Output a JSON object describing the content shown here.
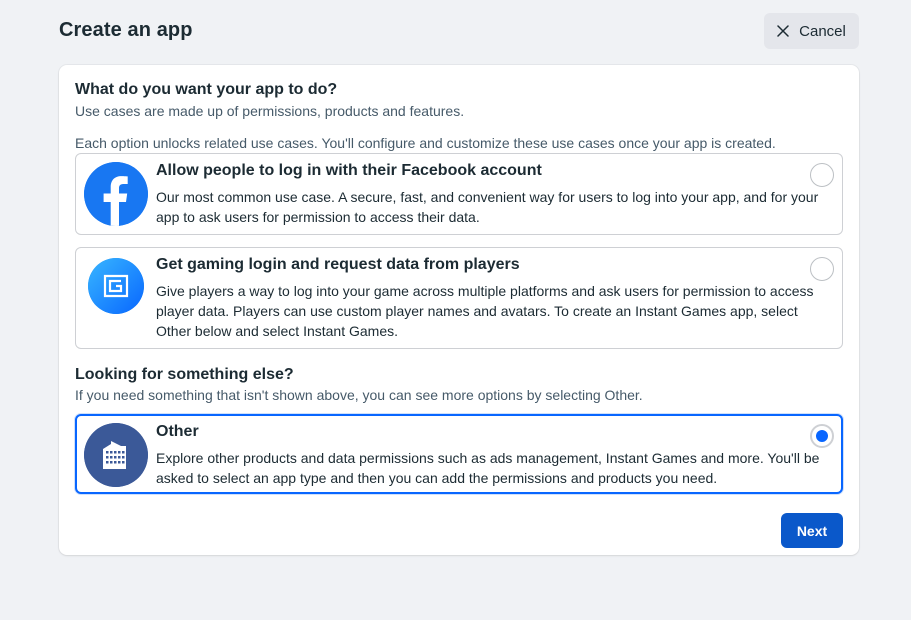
{
  "header": {
    "title": "Create an app",
    "cancel_label": "Cancel"
  },
  "section_main": {
    "title": "What do you want your app to do?",
    "subtitle": "Use cases are made up of permissions, products and features.",
    "note": "Each option unlocks related use cases. You'll configure and customize these use cases once your app is created."
  },
  "options": [
    {
      "title": "Allow people to log in with their Facebook account",
      "description": "Our most common use case. A secure, fast, and convenient way for users to log into your app, and for your app to ask users for permission to access their data.",
      "icon": "facebook-logo-icon",
      "selected": false
    },
    {
      "title": "Get gaming login and request data from players",
      "description": "Give players a way to log into your game across multiple platforms and ask users for permission to access player data. Players can use custom player names and avatars. To create an Instant Games app, select Other below and select Instant Games.",
      "icon": "gaming-icon",
      "selected": false
    }
  ],
  "section_other": {
    "title": "Looking for something else?",
    "subtitle": "If you need something that isn't shown above, you can see more options by selecting Other."
  },
  "other_option": {
    "title": "Other",
    "description": "Explore other products and data permissions such as ads management, Instant Games and more. You'll be asked to select an app type and then you can add the permissions and products you need.",
    "icon": "building-icon",
    "selected": true
  },
  "footer": {
    "next_label": "Next"
  },
  "colors": {
    "accent": "#0866ff",
    "button_primary": "#0a58ca",
    "facebook_blue": "#1877f2",
    "other_icon_bg": "#3b5998"
  }
}
